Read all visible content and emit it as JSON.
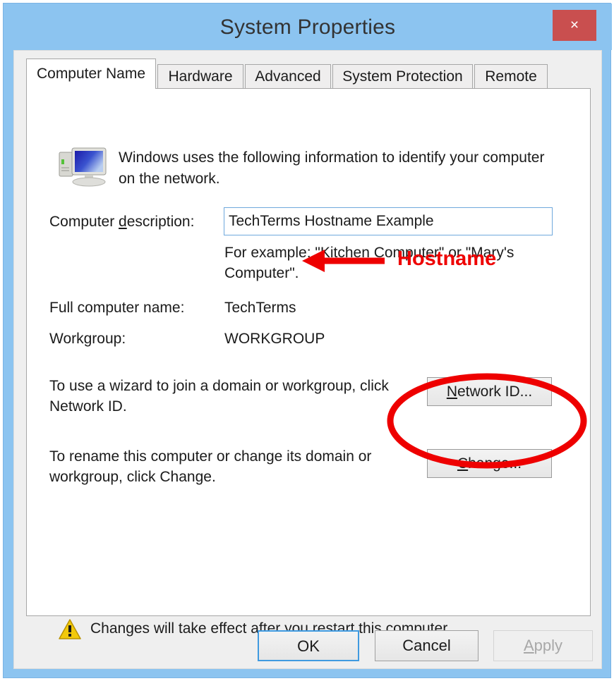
{
  "window": {
    "title": "System Properties",
    "close_label": "×",
    "frame_color": "#8cc4f0",
    "close_color": "#c94f4f"
  },
  "tabs": [
    {
      "label": "Computer Name",
      "active": true
    },
    {
      "label": "Hardware",
      "active": false
    },
    {
      "label": "Advanced",
      "active": false
    },
    {
      "label": "System Protection",
      "active": false
    },
    {
      "label": "Remote",
      "active": false
    }
  ],
  "panel": {
    "intro_line1": "Windows uses the following information to identify your computer",
    "intro_line2": "on the network.",
    "description": {
      "label_pre": "Computer ",
      "label_accel": "d",
      "label_post": "escription:",
      "value": "TechTerms Hostname Example",
      "placeholder": "",
      "hint_line1": "For example: \"Kitchen Computer\" or \"Mary's",
      "hint_line2": "Computer\"."
    },
    "full_computer_name": {
      "label": "Full computer name:",
      "value": "TechTerms"
    },
    "workgroup": {
      "label": "Workgroup:",
      "value": "WORKGROUP"
    },
    "network_id": {
      "text_line1": "To use a wizard to join a domain or workgroup, click",
      "text_line2": "Network ID.",
      "button_accel": "N",
      "button_rest": "etwork ID..."
    },
    "change": {
      "text_line1": "To rename this computer or change its domain or",
      "text_line2": "workgroup, click Change.",
      "button_accel": "C",
      "button_rest": "hange..."
    },
    "warning": {
      "icon": "warning-triangle-icon",
      "text": "Changes will take effect after you restart this computer."
    }
  },
  "footer": {
    "ok_label": "OK",
    "cancel_label": "Cancel",
    "apply_accel": "A",
    "apply_rest": "pply",
    "apply_disabled": true
  },
  "annotations": {
    "hostname_label": "Hostname",
    "color": "#ee0000",
    "arrow": "left-arrow-annotation",
    "ellipse": "ellipse-highlight-annotation"
  }
}
